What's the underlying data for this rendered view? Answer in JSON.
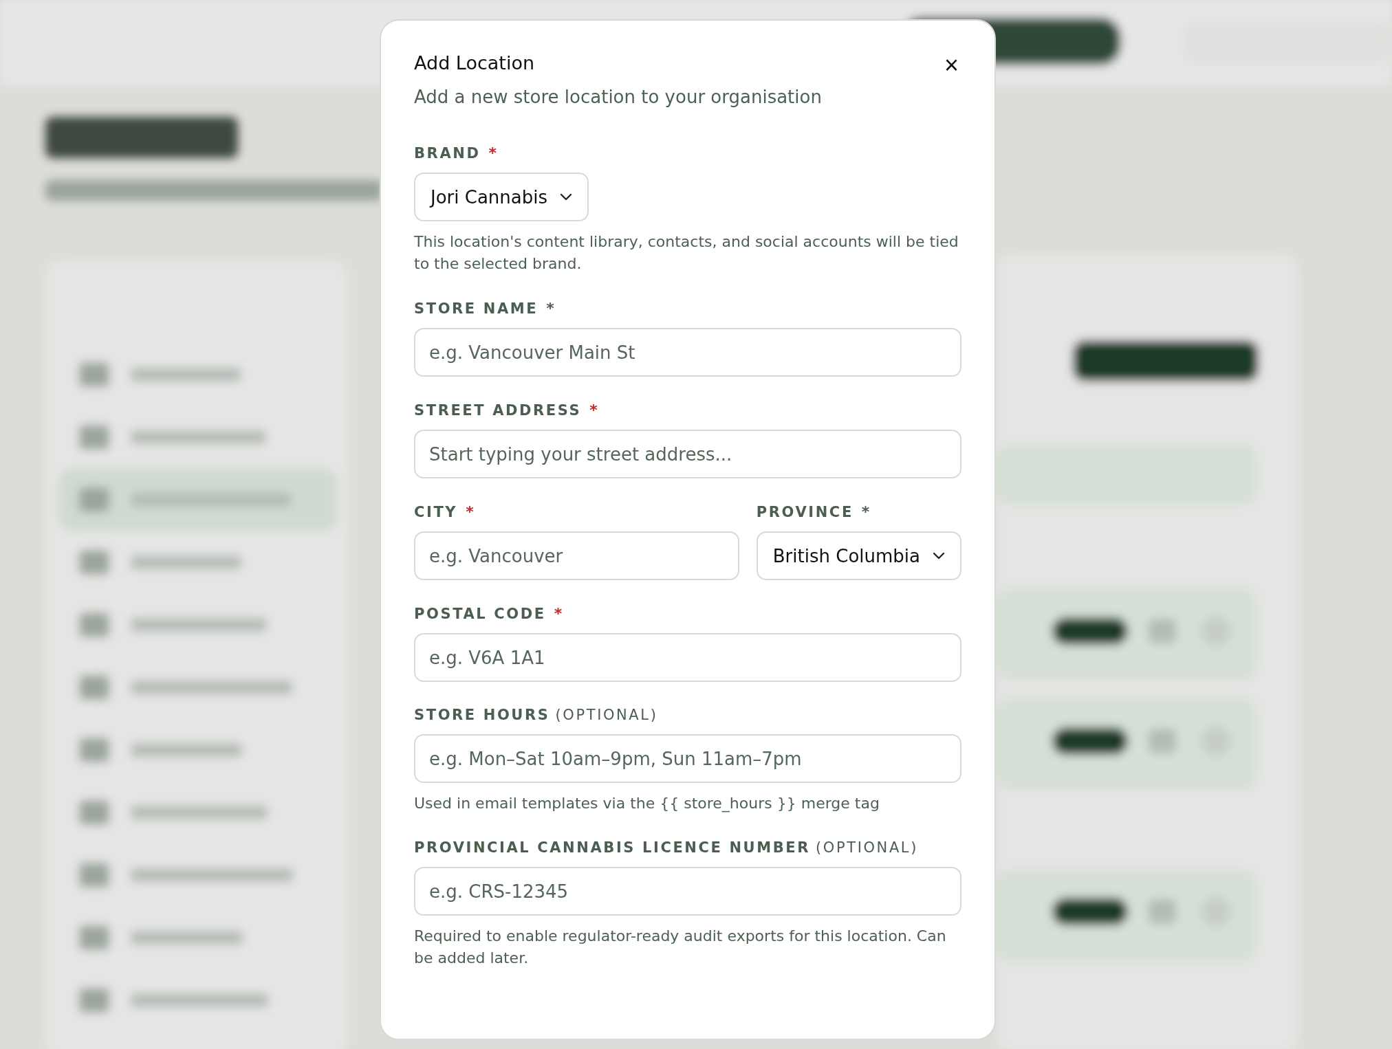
{
  "dialog": {
    "title": "Add Location",
    "subtitle": "Add a new store location to your organisation",
    "close": "×",
    "rows": [
      {
        "fields": [
          {
            "kind": "select",
            "label": "BRAND",
            "mark": {
              "text": "*",
              "color": "#c62828"
            },
            "value": "Jori Cannabis",
            "help": "This location's content library, contacts, and social accounts will be tied to the selected brand."
          }
        ]
      },
      {
        "fields": [
          {
            "kind": "input",
            "label": "STORE NAME",
            "mark": {
              "text": "*",
              "color": "#4b5e50"
            },
            "placeholder": "e.g. Vancouver Main St"
          }
        ]
      },
      {
        "fields": [
          {
            "kind": "input",
            "label": "STREET ADDRESS",
            "mark": {
              "text": "*",
              "color": "#c62828"
            },
            "placeholder": "Start typing your street address..."
          }
        ]
      },
      {
        "fields": [
          {
            "kind": "input",
            "label": "CITY",
            "mark": {
              "text": "*",
              "color": "#c62828"
            },
            "placeholder": "e.g. Vancouver"
          },
          {
            "kind": "select",
            "label": "PROVINCE",
            "mark": {
              "text": "*",
              "color": "#4b5e50"
            },
            "value": "British Columbia"
          }
        ]
      },
      {
        "fields": [
          {
            "kind": "input",
            "label": "POSTAL CODE",
            "mark": {
              "text": "*",
              "color": "#c62828"
            },
            "placeholder": "e.g. V6A 1A1"
          }
        ]
      },
      {
        "fields": [
          {
            "kind": "input",
            "label": "STORE HOURS",
            "note": "(OPTIONAL)",
            "placeholder": "e.g. Mon–Sat 10am–9pm, Sun 11am–7pm",
            "help": "Used in email templates via the {{ store_hours }} merge tag"
          }
        ]
      },
      {
        "fields": [
          {
            "kind": "input",
            "label": "PROVINCIAL CANNABIS LICENCE NUMBER",
            "note": "(OPTIONAL)",
            "placeholder": "e.g. CRS-12345",
            "help": "Required to enable regulator-ready audit exports for this location. Can be added later."
          }
        ]
      }
    ]
  }
}
